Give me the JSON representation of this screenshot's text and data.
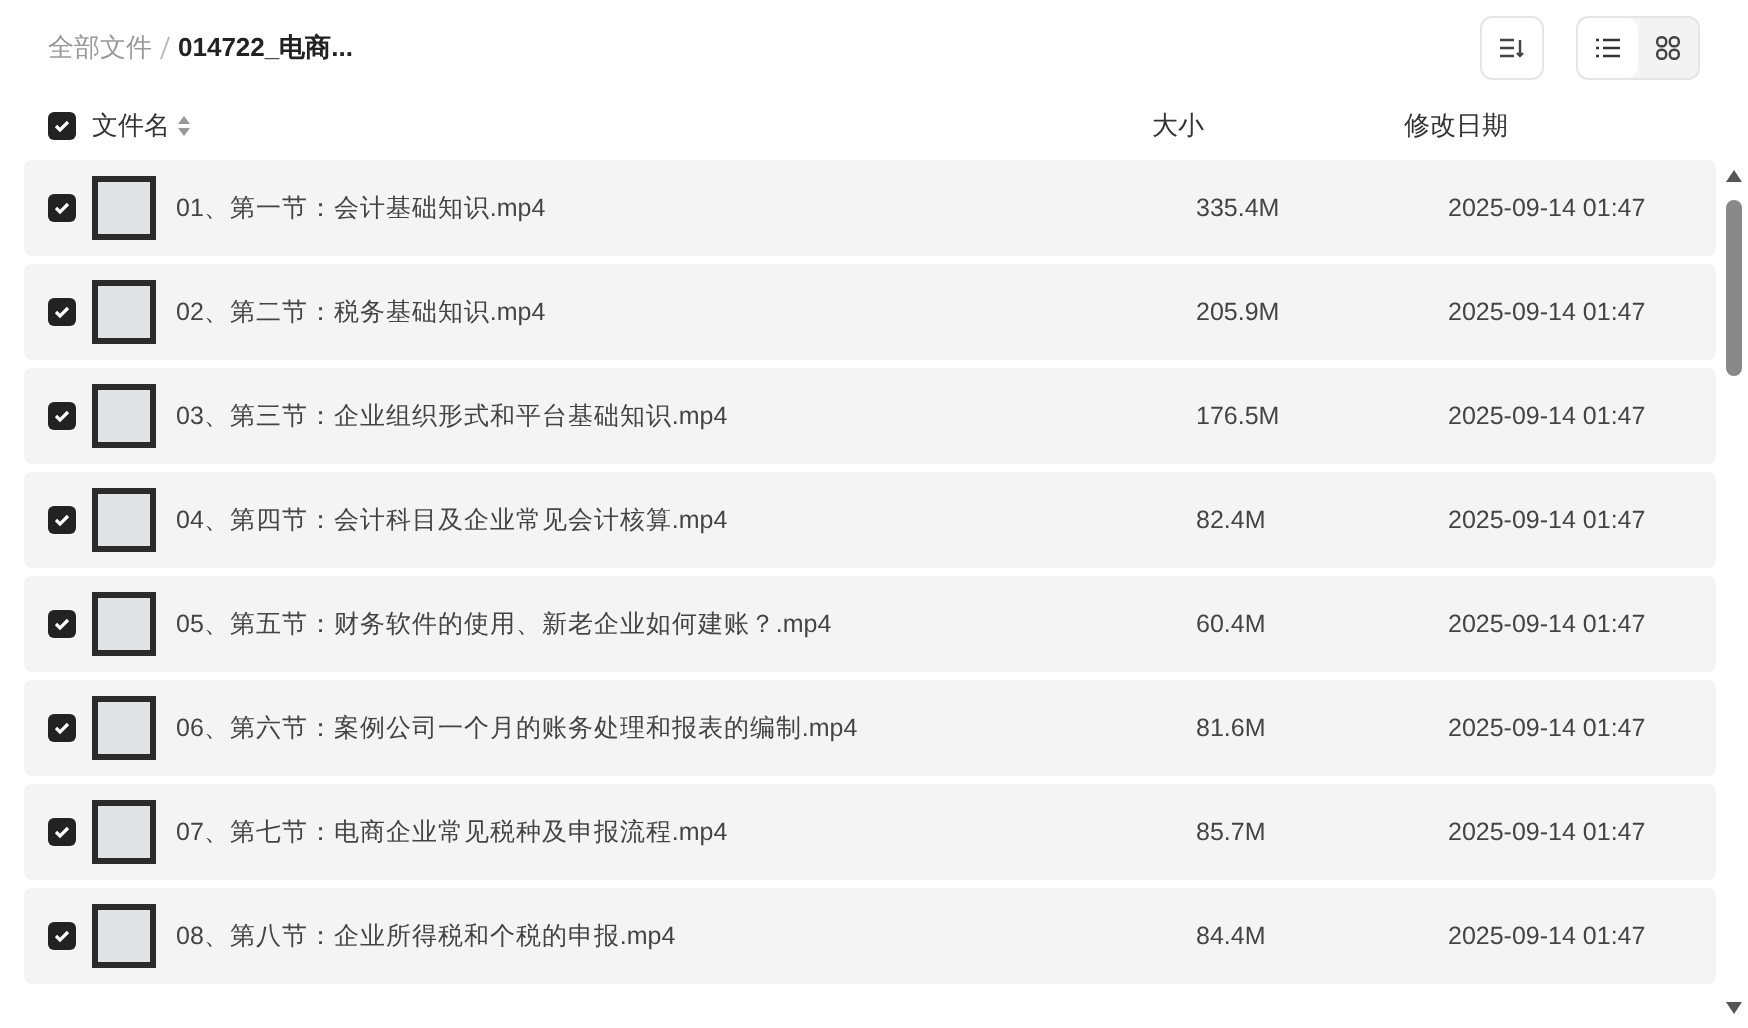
{
  "breadcrumb": [
    {
      "label": "全部文件",
      "current": false
    },
    {
      "label": "014722_电商...",
      "current": true
    }
  ],
  "view_toggle": [
    {
      "kind": "list",
      "selected": true
    },
    {
      "kind": "grid",
      "selected": false
    }
  ],
  "header": {
    "checked": true,
    "columns": [
      "文件名",
      "大小",
      "修改日期"
    ]
  },
  "files": [
    {
      "name": "01、第一节：会计基础知识.mp4",
      "size": "335.4M",
      "date": "2025-09-14 01:47",
      "checked": true
    },
    {
      "name": "02、第二节：税务基础知识.mp4",
      "size": "205.9M",
      "date": "2025-09-14 01:47",
      "checked": true
    },
    {
      "name": "03、第三节：企业组织形式和平台基础知识.mp4",
      "size": "176.5M",
      "date": "2025-09-14 01:47",
      "checked": true
    },
    {
      "name": "04、第四节：会计科目及企业常见会计核算.mp4",
      "size": "82.4M",
      "date": "2025-09-14 01:47",
      "checked": true
    },
    {
      "name": "05、第五节：财务软件的使用、新老企业如何建账？.mp4",
      "size": "60.4M",
      "date": "2025-09-14 01:47",
      "checked": true
    },
    {
      "name": "06、第六节：案例公司一个月的账务处理和报表的编制.mp4",
      "size": "81.6M",
      "date": "2025-09-14 01:47",
      "checked": true
    },
    {
      "name": "07、第七节：电商企业常见税种及申报流程.mp4",
      "size": "85.7M",
      "date": "2025-09-14 01:47",
      "checked": true
    },
    {
      "name": "08、第八节：企业所得税和个税的申报.mp4",
      "size": "84.4M",
      "date": "2025-09-14 01:47",
      "checked": true
    }
  ]
}
